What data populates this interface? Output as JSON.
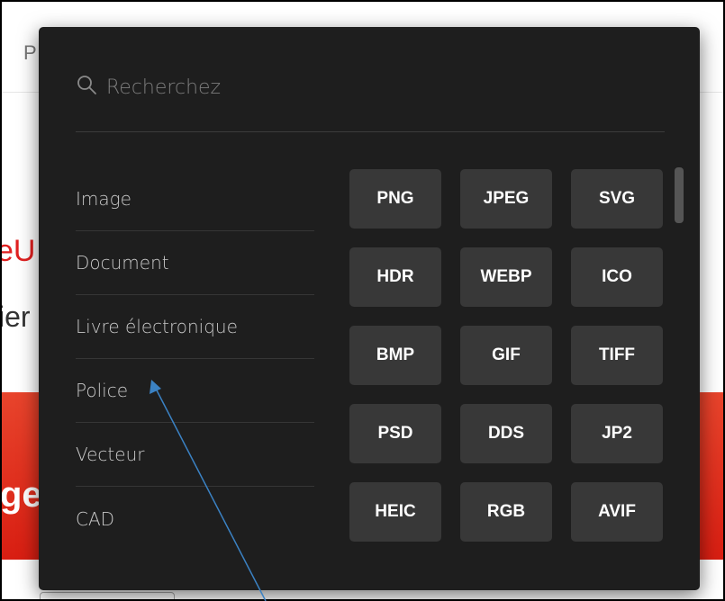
{
  "background": {
    "partial_top_letter": "P",
    "partial_red_text": "eU",
    "partial_text": "ier",
    "partial_banner_text": "ge"
  },
  "dropdown": {
    "search": {
      "placeholder": "Recherchez",
      "value": ""
    },
    "categories": [
      {
        "label": "Image"
      },
      {
        "label": "Document"
      },
      {
        "label": "Livre électronique"
      },
      {
        "label": "Police"
      },
      {
        "label": "Vecteur"
      },
      {
        "label": "CAD"
      }
    ],
    "formats": [
      [
        "PNG",
        "JPEG",
        "SVG"
      ],
      [
        "HDR",
        "WEBP",
        "ICO"
      ],
      [
        "BMP",
        "GIF",
        "TIFF"
      ],
      [
        "PSD",
        "DDS",
        "JP2"
      ],
      [
        "HEIC",
        "RGB",
        "AVIF"
      ]
    ]
  },
  "colors": {
    "panel_bg": "#1e1e1e",
    "button_bg": "#383838",
    "accent_red": "#e02020",
    "cursor_blue": "#3b82c4"
  }
}
